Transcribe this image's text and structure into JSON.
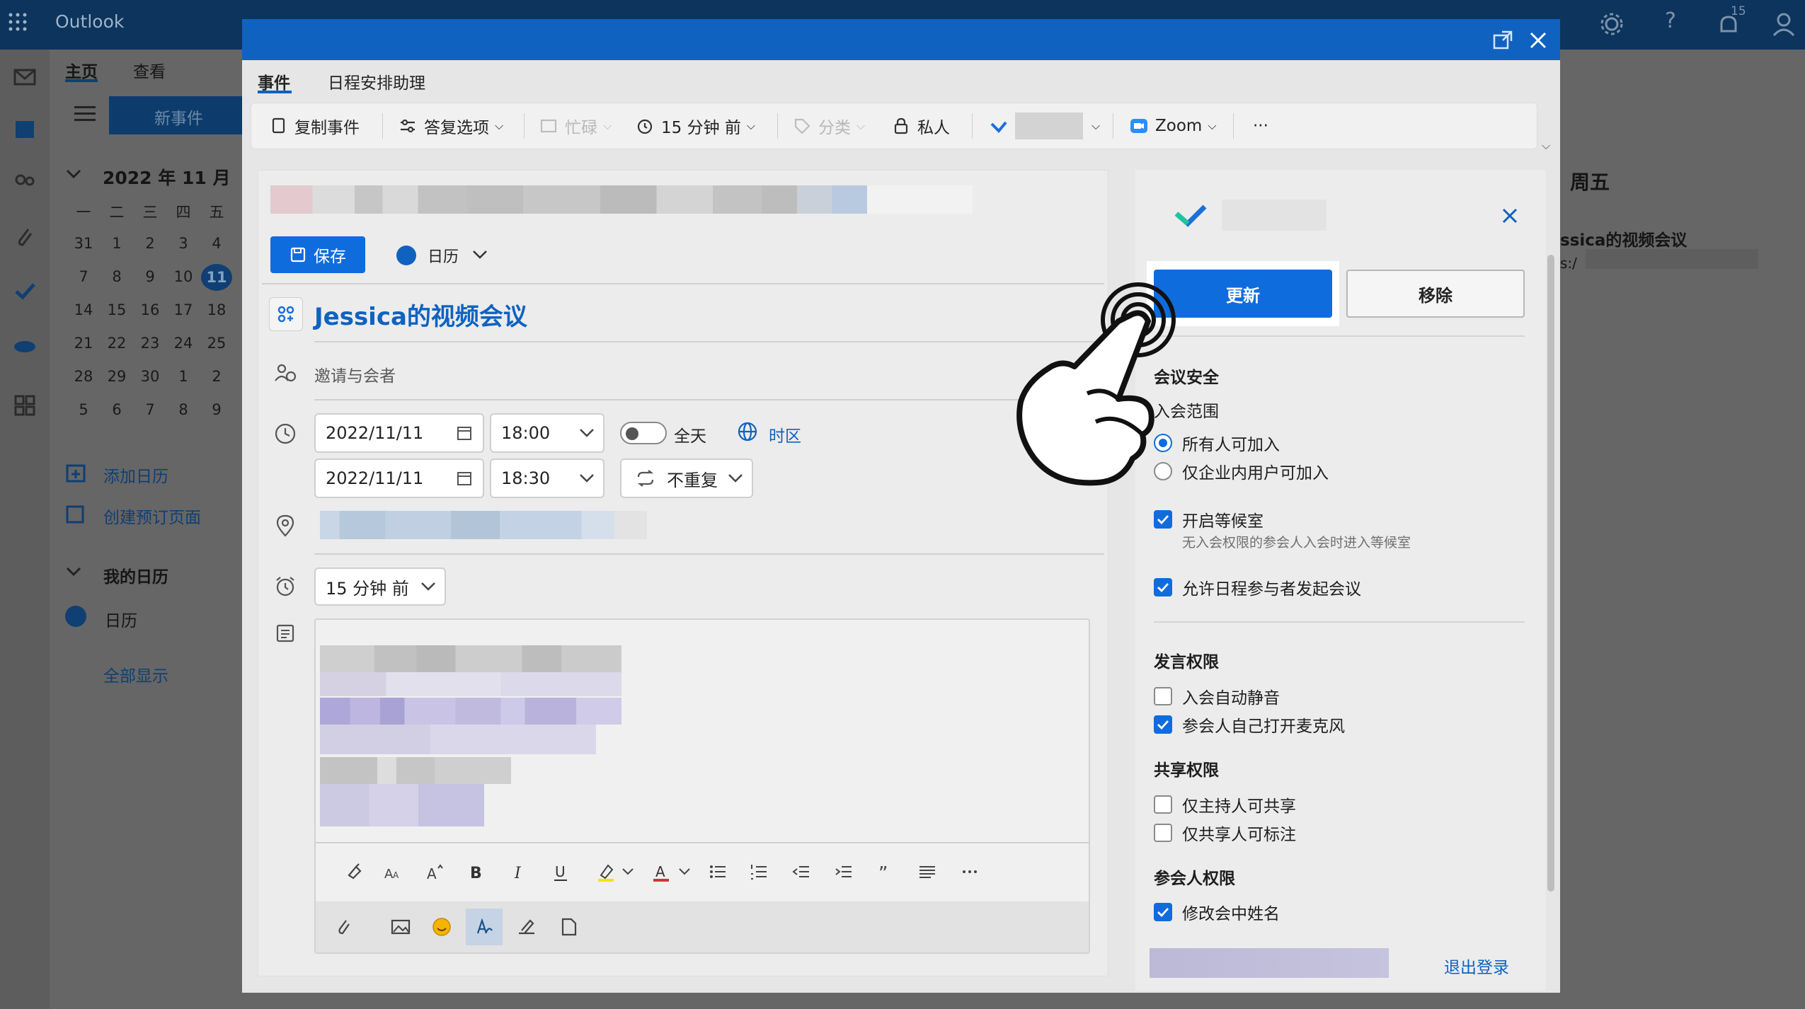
{
  "app": {
    "name": "Outlook"
  },
  "background": {
    "ribbon_tabs": [
      "主页",
      "查看"
    ],
    "new_event_label": "新事件",
    "month_title": "2022 年 11 月",
    "weekdays": [
      "一",
      "二",
      "三",
      "四",
      "五"
    ],
    "weeks": [
      [
        "31",
        "1",
        "2",
        "3",
        "4"
      ],
      [
        "7",
        "8",
        "9",
        "10",
        "11"
      ],
      [
        "14",
        "15",
        "16",
        "17",
        "18"
      ],
      [
        "21",
        "22",
        "23",
        "24",
        "25"
      ],
      [
        "28",
        "29",
        "30",
        "1",
        "2"
      ],
      [
        "5",
        "6",
        "7",
        "8",
        "9"
      ]
    ],
    "today": "11",
    "add_calendar": "添加日历",
    "create_booking": "创建预订页面",
    "my_calendars": "我的日历",
    "calendar_item": "日历",
    "show_all": "全部显示",
    "day_header": "周五",
    "event_preview": "ssica的视频会议",
    "event_preview_url": "s:/",
    "notification_count": "15"
  },
  "dialog": {
    "tabs": [
      "事件",
      "日程安排助理"
    ],
    "toolbar": {
      "copy_event": "复制事件",
      "response_options": "答复选项",
      "busy": "忙碌",
      "reminder": "15 分钟 前",
      "categorize": "分类",
      "private": "私人",
      "zoom": "Zoom",
      "more": "···"
    },
    "save_label": "保存",
    "calendar_label": "日历",
    "event_title": "Jessica的视频会议",
    "invite_placeholder": "邀请与会者",
    "start_date": "2022/11/11",
    "start_time": "18:00",
    "end_date": "2022/11/11",
    "end_time": "18:30",
    "all_day_label": "全天",
    "timezone_label": "时区",
    "repeat_label": "不重复",
    "reminder_select": "15 分钟 前"
  },
  "panel": {
    "update_label": "更新",
    "remove_label": "移除",
    "meeting_security": "会议安全",
    "join_scope": "入会范围",
    "radio_all": "所有人可加入",
    "radio_enterprise": "仅企业内用户可加入",
    "waiting_room": "开启等候室",
    "waiting_room_hint": "无入会权限的参会人入会时进入等候室",
    "allow_start": "允许日程参与者发起会议",
    "speaking": "发言权限",
    "auto_mute": "入会自动静音",
    "self_unmute": "参会人自己打开麦克风",
    "sharing": "共享权限",
    "host_share": "仅主持人可共享",
    "sharer_annotate": "仅共享人可标注",
    "participant": "参会人权限",
    "rename": "修改会中姓名",
    "logout": "退出登录"
  },
  "colors": {
    "accent": "#0f6cdd",
    "title_bar": "#0f62c0",
    "top_bar": "#0c345c"
  }
}
